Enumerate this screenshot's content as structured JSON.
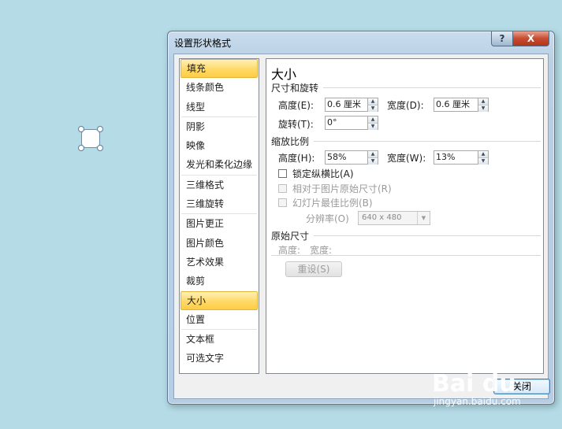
{
  "dialog": {
    "title": "设置形状格式",
    "help_glyph": "?",
    "close_glyph": "X"
  },
  "nav": {
    "items": [
      {
        "label": "填充",
        "selected": true
      },
      {
        "label": "线条颜色"
      },
      {
        "label": "线型"
      },
      {
        "label": "阴影"
      },
      {
        "label": "映像"
      },
      {
        "label": "发光和柔化边缘"
      },
      {
        "label": "三维格式"
      },
      {
        "label": "三维旋转"
      },
      {
        "label": "图片更正"
      },
      {
        "label": "图片颜色"
      },
      {
        "label": "艺术效果"
      },
      {
        "label": "裁剪"
      },
      {
        "label": "大小",
        "selected": true
      },
      {
        "label": "位置"
      },
      {
        "label": "文本框"
      },
      {
        "label": "可选文字"
      }
    ]
  },
  "panel": {
    "heading": "大小",
    "size_rotate": {
      "group_label": "尺寸和旋转",
      "height_label": "高度(E):",
      "height_value": "0.6 厘米",
      "width_label": "宽度(D):",
      "width_value": "0.6 厘米",
      "rotate_label": "旋转(T):",
      "rotate_value": "0°"
    },
    "scale": {
      "group_label": "缩放比例",
      "height_label": "高度(H):",
      "height_value": "58%",
      "width_label": "宽度(W):",
      "width_value": "13%",
      "lock_aspect_label": "锁定纵横比(A)",
      "relative_label": "相对于图片原始尺寸(R)",
      "slideshow_label": "幻灯片最佳比例(B)",
      "resolution_label": "分辨率(O)",
      "resolution_value": "640 x 480"
    },
    "original": {
      "group_label": "原始尺寸",
      "height_label": "高度:",
      "width_label": "宽度:",
      "reset_label": "重设(S)"
    }
  },
  "footer": {
    "close_label": "关闭"
  },
  "watermark": {
    "logo": "Bai du",
    "site": "jingyan.baidu.com"
  },
  "colors": {
    "desktop": "#b4dbe6",
    "selection_yellow": "#ffd966",
    "close_red": "#c74b2e"
  }
}
